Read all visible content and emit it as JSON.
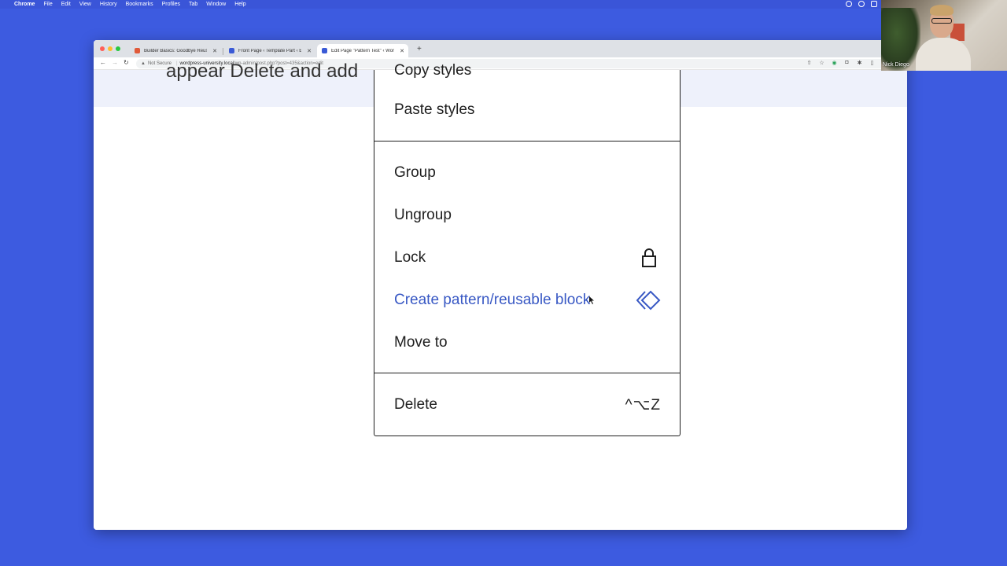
{
  "menubar": {
    "app": "Chrome",
    "items": [
      "File",
      "Edit",
      "View",
      "History",
      "Bookmarks",
      "Profiles",
      "Tab",
      "Window",
      "Help"
    ]
  },
  "browser": {
    "tabs": [
      {
        "title": "Builder Basics: Goodbye Reus",
        "active": false
      },
      {
        "title": "Front Page ‹ Template Part ‹ E",
        "active": false
      },
      {
        "title": "Edit Page \"Pattern Test\" ‹ Wor",
        "active": true
      }
    ],
    "url": {
      "security_label": "Not Secure",
      "host": "wordpress-university.local",
      "path": "/wp-admin/post.php?post=435&action=edit"
    }
  },
  "page": {
    "banner_text": "appear Delete and add"
  },
  "menu": {
    "group1": [
      {
        "label": "Copy styles"
      },
      {
        "label": "Paste styles"
      }
    ],
    "group2": [
      {
        "label": "Group"
      },
      {
        "label": "Ungroup"
      },
      {
        "label": "Lock",
        "icon": "lock-icon"
      },
      {
        "label": "Create pattern/reusable block",
        "icon": "diamond-icon",
        "highlighted": true
      },
      {
        "label": "Move to"
      }
    ],
    "group3": [
      {
        "label": "Delete",
        "shortcut": "^⌥Z"
      }
    ],
    "accent_color": "#3858c4"
  },
  "webcam": {
    "name": "Nick Diego"
  }
}
